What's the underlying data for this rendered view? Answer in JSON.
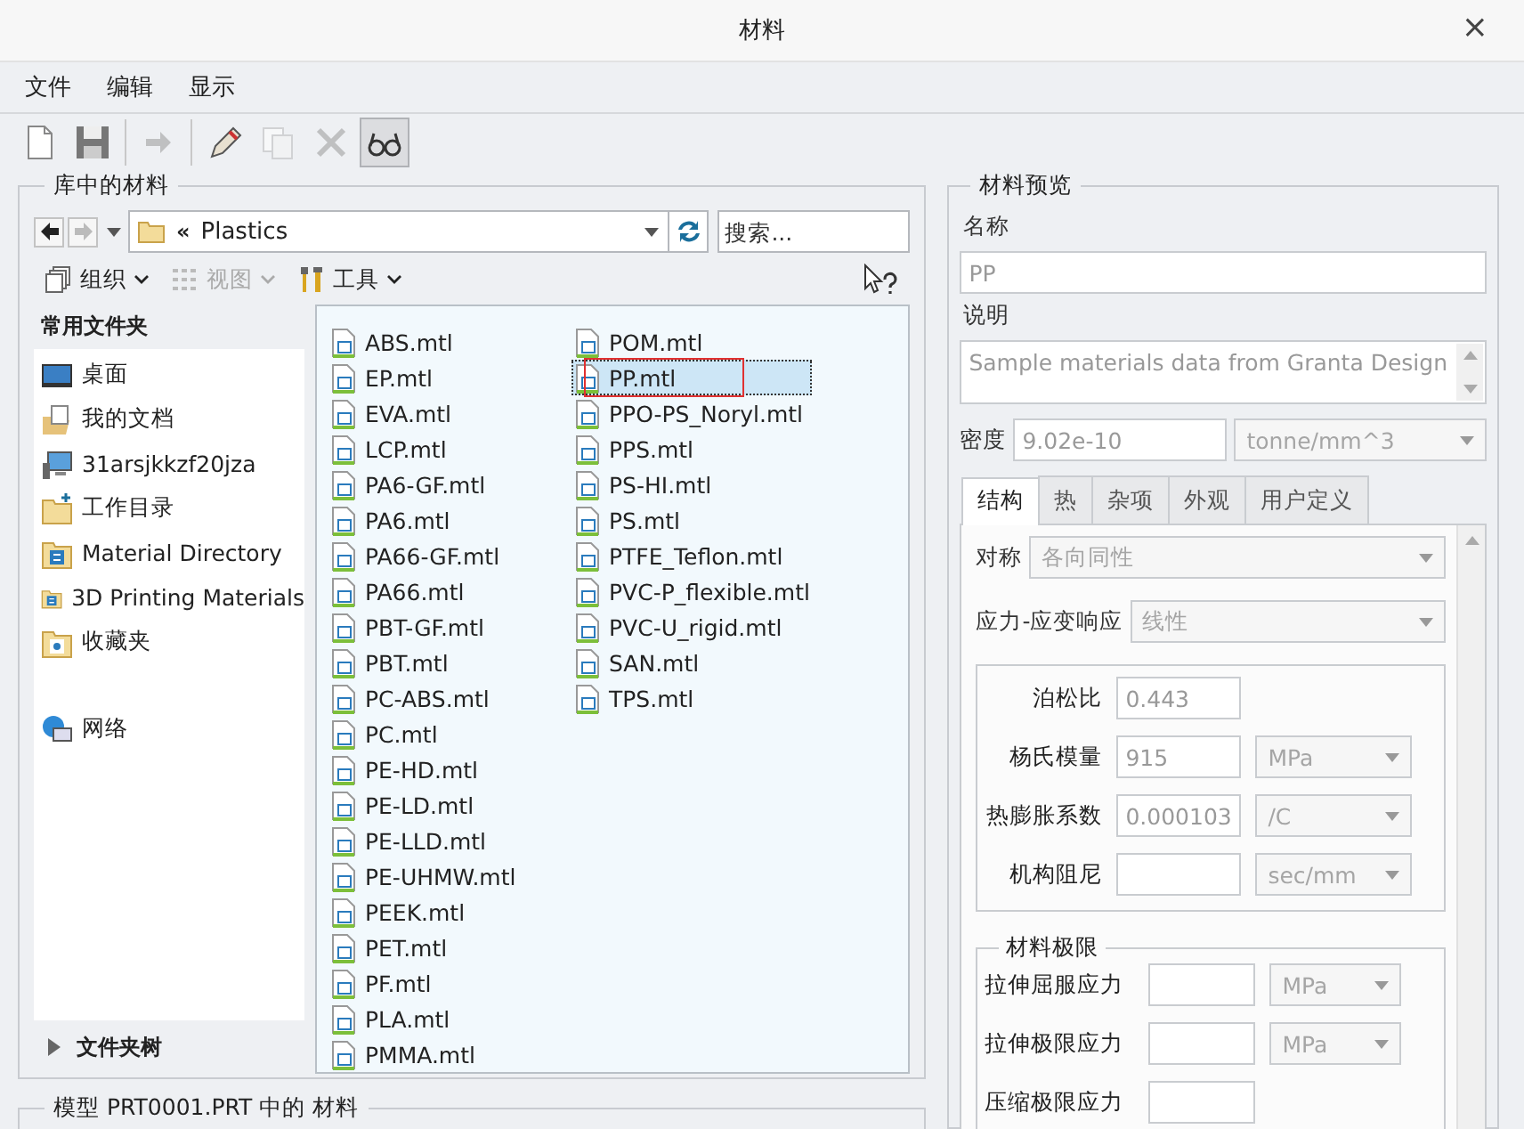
{
  "window": {
    "title": "材料",
    "close": "×"
  },
  "menu": [
    "文件",
    "编辑",
    "显示"
  ],
  "toolbar": [
    {
      "kind": "new",
      "disabled": false,
      "on": false
    },
    {
      "kind": "save",
      "disabled": false,
      "on": false
    },
    {
      "kind": "separator"
    },
    {
      "kind": "move",
      "disabled": true,
      "on": false
    },
    {
      "kind": "separator"
    },
    {
      "kind": "edit",
      "disabled": false,
      "on": false
    },
    {
      "kind": "copy",
      "disabled": true,
      "on": false
    },
    {
      "kind": "delete",
      "disabled": true,
      "on": false
    },
    {
      "kind": "view",
      "disabled": false,
      "on": true
    }
  ],
  "library": {
    "legend": "库中的材料",
    "back": {
      "disabled": false
    },
    "forward": {
      "disabled": true
    },
    "address": {
      "prefix": "«",
      "path": "Plastics"
    },
    "search": {
      "placeholder": "搜索..."
    },
    "commands": [
      {
        "kind": "organize",
        "label": "组织",
        "disabled": false
      },
      {
        "kind": "view",
        "label": "视图",
        "disabled": true
      },
      {
        "kind": "tools",
        "label": "工具",
        "disabled": false
      }
    ],
    "sidebar": {
      "title": "常用文件夹",
      "items": [
        {
          "kind": "desktop",
          "label": "桌面"
        },
        {
          "kind": "documents",
          "label": "我的文档"
        },
        {
          "kind": "computer",
          "label": "31arsjkkzf20jza"
        },
        {
          "kind": "workdir",
          "label": "工作目录"
        },
        {
          "kind": "library",
          "label": "Material Directory"
        },
        {
          "kind": "library",
          "label": "3D Printing Materials"
        },
        {
          "kind": "favorites",
          "label": "收藏夹"
        },
        {
          "kind": "network",
          "label": "网络"
        }
      ]
    },
    "folder_tree": {
      "label": "文件夹树",
      "expanded": false
    },
    "files": [
      {
        "name": "ABS.mtl",
        "selected": false
      },
      {
        "name": "EP.mtl",
        "selected": false
      },
      {
        "name": "EVA.mtl",
        "selected": false
      },
      {
        "name": "LCP.mtl",
        "selected": false
      },
      {
        "name": "PA6-GF.mtl",
        "selected": false
      },
      {
        "name": "PA6.mtl",
        "selected": false
      },
      {
        "name": "PA66-GF.mtl",
        "selected": false
      },
      {
        "name": "PA66.mtl",
        "selected": false
      },
      {
        "name": "PBT-GF.mtl",
        "selected": false
      },
      {
        "name": "PBT.mtl",
        "selected": false
      },
      {
        "name": "PC-ABS.mtl",
        "selected": false
      },
      {
        "name": "PC.mtl",
        "selected": false
      },
      {
        "name": "PE-HD.mtl",
        "selected": false
      },
      {
        "name": "PE-LD.mtl",
        "selected": false
      },
      {
        "name": "PE-LLD.mtl",
        "selected": false
      },
      {
        "name": "PE-UHMW.mtl",
        "selected": false
      },
      {
        "name": "PEEK.mtl",
        "selected": false
      },
      {
        "name": "PET.mtl",
        "selected": false
      },
      {
        "name": "PF.mtl",
        "selected": false
      },
      {
        "name": "PLA.mtl",
        "selected": false
      },
      {
        "name": "PMMA.mtl",
        "selected": false
      },
      {
        "name": "POM.mtl",
        "selected": false
      },
      {
        "name": "PP.mtl",
        "selected": true
      },
      {
        "name": "PPO-PS_Noryl.mtl",
        "selected": false
      },
      {
        "name": "PPS.mtl",
        "selected": false
      },
      {
        "name": "PS-HI.mtl",
        "selected": false
      },
      {
        "name": "PS.mtl",
        "selected": false
      },
      {
        "name": "PTFE_Teflon.mtl",
        "selected": false
      },
      {
        "name": "PVC-P_flexible.mtl",
        "selected": false
      },
      {
        "name": "PVC-U_rigid.mtl",
        "selected": false
      },
      {
        "name": "SAN.mtl",
        "selected": false
      },
      {
        "name": "TPS.mtl",
        "selected": false
      }
    ]
  },
  "model_group": {
    "legend": "模型 PRT0001.PRT 中的 材料"
  },
  "preview": {
    "legend": "材料预览",
    "name_label": "名称",
    "name_value": "PP",
    "description_label": "说明",
    "description_value": "Sample materials data from Granta Design",
    "density_label": "密度",
    "density_value": "9.02e-10",
    "density_unit": "tonne/mm^3",
    "tabs": [
      {
        "label": "结构",
        "selected": true
      },
      {
        "label": "热",
        "selected": false
      },
      {
        "label": "杂项",
        "selected": false
      },
      {
        "label": "外观",
        "selected": false
      },
      {
        "label": "用户定义",
        "selected": false
      }
    ],
    "symmetry": {
      "label": "对称",
      "value": "各向同性"
    },
    "response": {
      "label": "应力-应变响应",
      "value": "线性"
    },
    "properties": [
      {
        "label": "泊松比",
        "value": "0.443"
      },
      {
        "label": "杨氏模量",
        "value": "915",
        "unit": "MPa"
      },
      {
        "label": "热膨胀系数",
        "value": "0.000103",
        "unit": "/C"
      },
      {
        "label": "机构阻尼",
        "unit": "sec/mm"
      }
    ],
    "limits": {
      "title": "材料极限",
      "rows": [
        {
          "label": "拉伸屈服应力",
          "unit": "MPa"
        },
        {
          "label": "拉伸极限应力",
          "unit": "MPa"
        },
        {
          "label": "压缩极限应力"
        }
      ]
    }
  }
}
